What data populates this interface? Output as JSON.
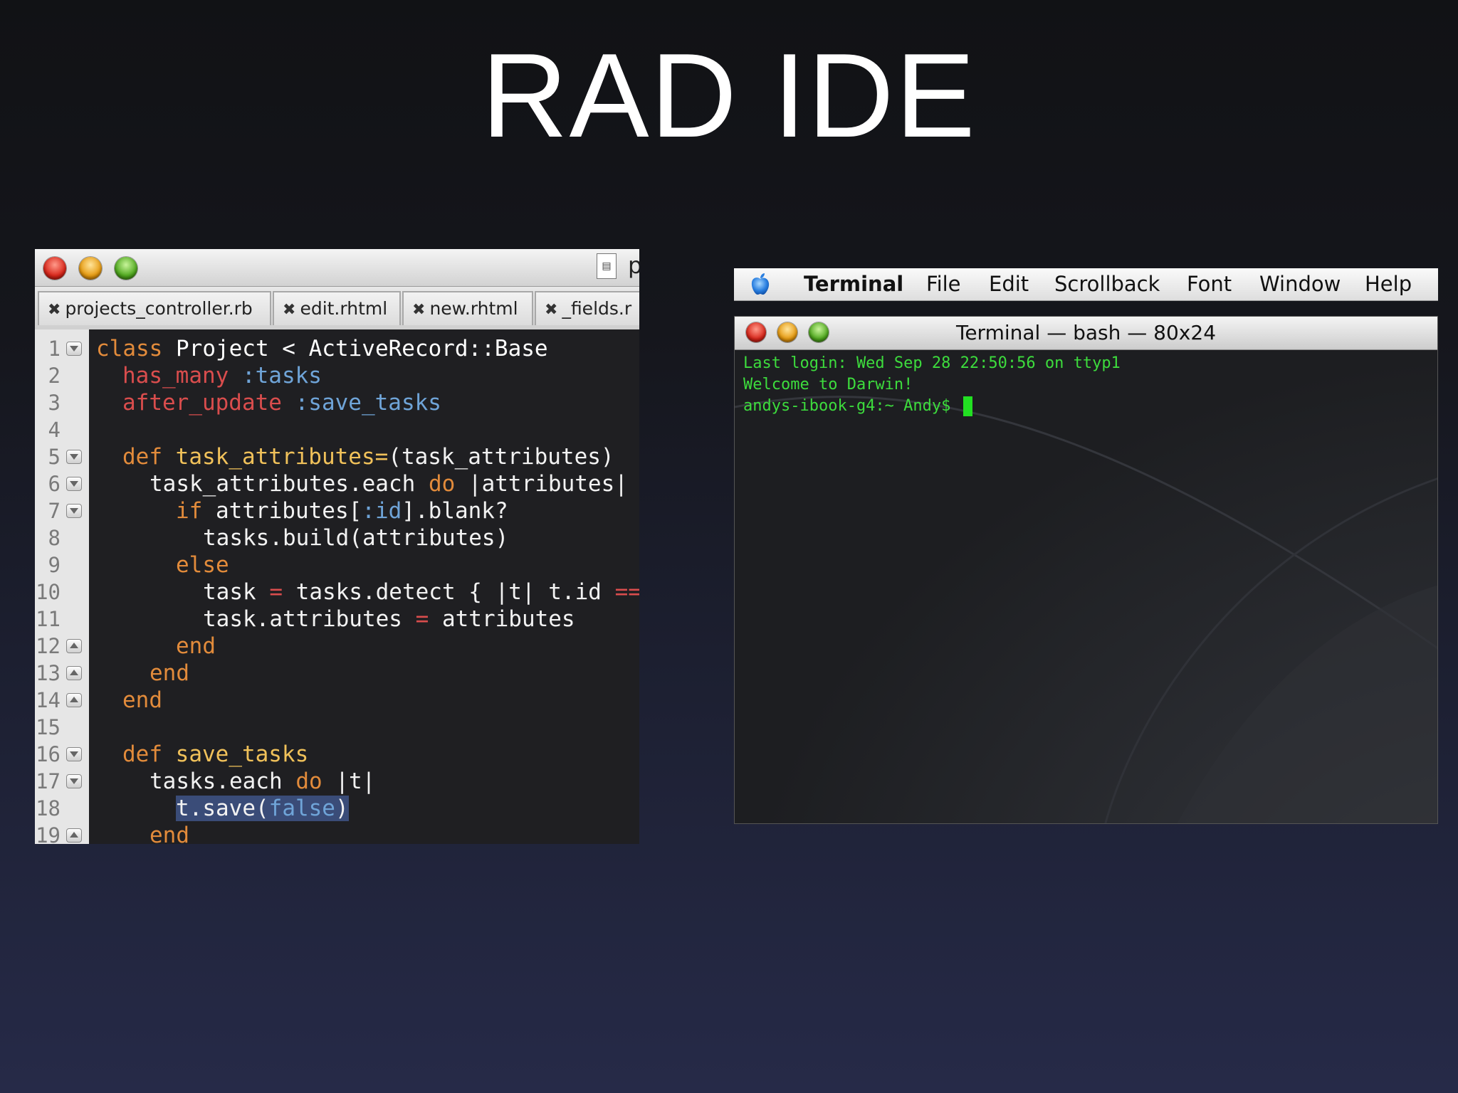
{
  "slide": {
    "title": "RAD IDE"
  },
  "editor": {
    "proxy_letter": "p",
    "tabs": [
      {
        "label": "projects_controller.rb"
      },
      {
        "label": "edit.rhtml"
      },
      {
        "label": "new.rhtml"
      },
      {
        "label": "_fields.r"
      }
    ],
    "close_glyph": "✖",
    "line_numbers": [
      "1",
      "2",
      "3",
      "4",
      "5",
      "6",
      "7",
      "8",
      "9",
      "10",
      "11",
      "12",
      "13",
      "14",
      "15",
      "16",
      "17",
      "18",
      "19"
    ],
    "code": {
      "l1": {
        "a": "class",
        "b": " Project < ActiveRecord::Base"
      },
      "l2": {
        "a": "has_many",
        "b": " :tasks"
      },
      "l3": {
        "a": "after_update",
        "b": " :save_tasks"
      },
      "l5": {
        "a": "def",
        "b": " task_attributes=",
        "c": "(task_attributes)"
      },
      "l6": {
        "a": "task_attributes.each ",
        "b": "do",
        "c": " |attributes|"
      },
      "l7": {
        "a": "if",
        "b": " attributes[",
        "c": ":id",
        "d": "].blank?"
      },
      "l8": {
        "a": "tasks.build(attributes)"
      },
      "l9": {
        "a": "else"
      },
      "l10": {
        "a": "task ",
        "b": "=",
        "c": " tasks.detect { |t| t.id ",
        "d": "=="
      },
      "l11": {
        "a": "task.attributes ",
        "b": "=",
        "c": " attributes"
      },
      "l12": {
        "a": "end"
      },
      "l13": {
        "a": "end"
      },
      "l14": {
        "a": "end"
      },
      "l16": {
        "a": "def",
        "b": " save_tasks"
      },
      "l17": {
        "a": "tasks.each ",
        "b": "do",
        "c": " |t|"
      },
      "l18": {
        "a": "t.save(",
        "b": "false",
        "c": ")"
      },
      "l19": {
        "a": "end"
      }
    }
  },
  "terminal": {
    "menu": {
      "app": "Terminal",
      "items": [
        "File",
        "Edit",
        "Scrollback",
        "Font",
        "Window",
        "Help"
      ]
    },
    "window_title": "Terminal — bash — 80x24",
    "lines": [
      "Last login: Wed Sep 28 22:50:56 on ttyp1",
      "Welcome to Darwin!",
      "andys-ibook-g4:~ Andy$ "
    ]
  },
  "colors": {
    "keyword": "#e28b3b",
    "rails_method": "#d94d4d",
    "symbol": "#6fa4d8",
    "method_name": "#f0c15a",
    "terminal_text": "#3ddc3d"
  }
}
